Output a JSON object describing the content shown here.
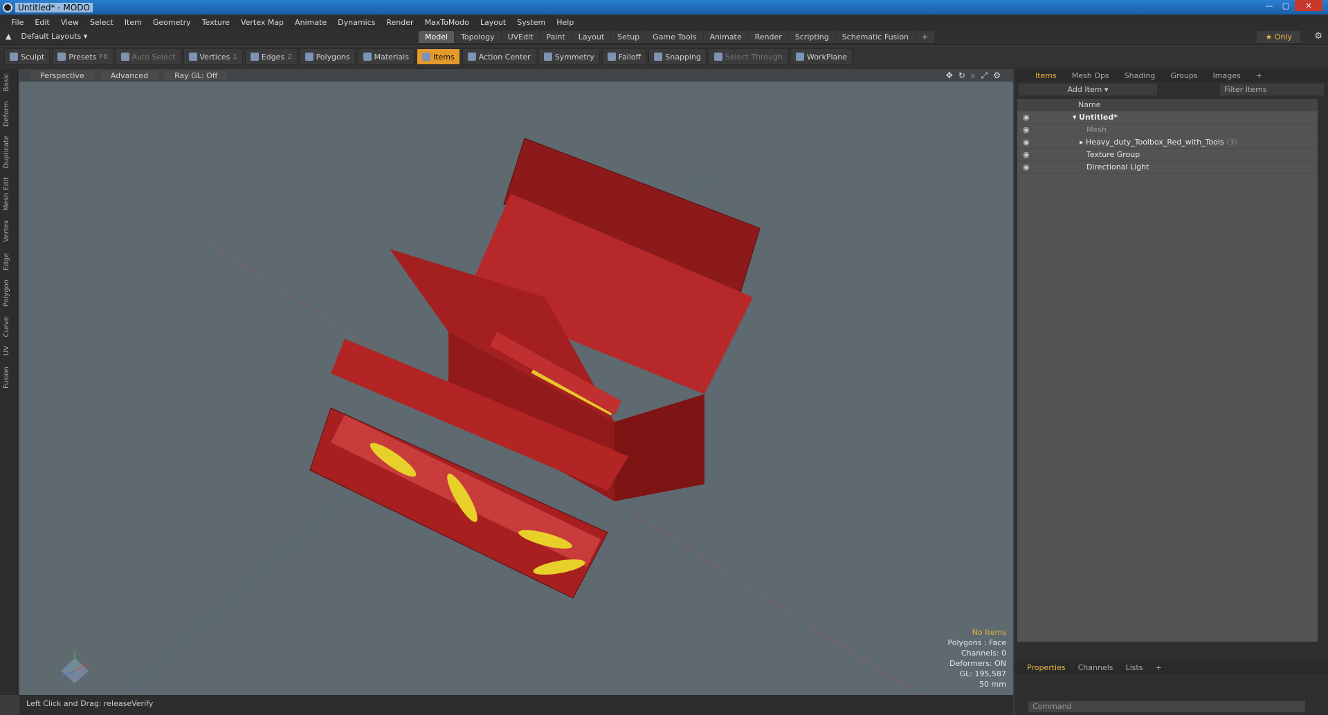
{
  "window": {
    "title": "Untitled* - MODO"
  },
  "menu": [
    "File",
    "Edit",
    "View",
    "Select",
    "Item",
    "Geometry",
    "Texture",
    "Vertex Map",
    "Animate",
    "Dynamics",
    "Render",
    "MaxToModo",
    "Layout",
    "System",
    "Help"
  ],
  "layouts": {
    "label": "Default Layouts"
  },
  "tabs": [
    "Model",
    "Topology",
    "UVEdit",
    "Paint",
    "Layout",
    "Setup",
    "Game Tools",
    "Animate",
    "Render",
    "Scripting",
    "Schematic Fusion"
  ],
  "only_label": "Only",
  "toolbar": {
    "sculpt": "Sculpt",
    "presets": "Presets",
    "presets_key": "F6",
    "auto_select": "Auto Select",
    "vertices": "Vertices",
    "vertices_key": "1",
    "edges": "Edges",
    "edges_key": "2",
    "polygons": "Polygons",
    "materials": "Materials",
    "items": "Items",
    "action_center": "Action Center",
    "symmetry": "Symmetry",
    "falloff": "Falloff",
    "snapping": "Snapping",
    "select_through": "Select Through",
    "workplane": "WorkPlane"
  },
  "left_tabs": [
    "Basic",
    "Deform",
    "Duplicate",
    "Mesh Edit",
    "Vertex",
    "Edge",
    "Polygon",
    "Curve",
    "UV",
    "Fusion"
  ],
  "viewport": {
    "view": "Perspective",
    "mode": "Advanced",
    "raygl": "Ray GL: Off",
    "stats": {
      "items": "No Items",
      "polygons": "Polygons : Face",
      "channels": "Channels: 0",
      "deformers": "Deformers: ON",
      "gl": "GL: 195,587",
      "size": "50 mm"
    }
  },
  "status": "Left Click and Drag:   releaseVerify",
  "panel": {
    "tabs": [
      "Items",
      "Mesh Ops",
      "Shading",
      "Groups",
      "Images"
    ],
    "add_item": "Add Item",
    "filter": "Filter Items",
    "header_name": "Name",
    "items": [
      {
        "label": "Untitled*"
      },
      {
        "label": "Mesh"
      },
      {
        "label": "Heavy_duty_Toolbox_Red_with_Tools",
        "count": "(3)"
      },
      {
        "label": "Texture Group"
      },
      {
        "label": "Directional Light"
      }
    ],
    "bottom_tabs": [
      "Properties",
      "Channels",
      "Lists"
    ],
    "command": "Command"
  }
}
